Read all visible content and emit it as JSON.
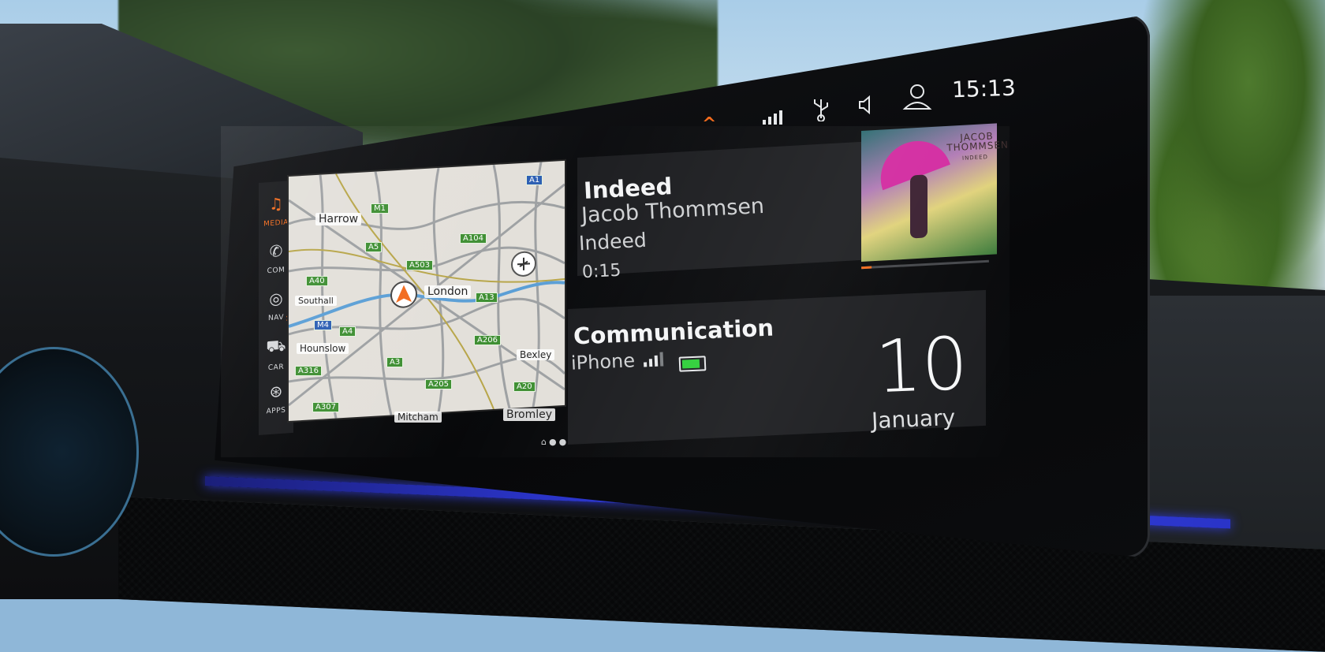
{
  "status_bar": {
    "time": "15:13",
    "icons": [
      "signal-icon",
      "usb-icon",
      "speaker-icon",
      "user-icon"
    ],
    "accent_color": "#f26b1d"
  },
  "sidebar": {
    "items": [
      {
        "label": "MEDIA",
        "icon": "music-note-icon",
        "active": true
      },
      {
        "label": "COM",
        "icon": "phone-icon",
        "active": false
      },
      {
        "label": "NAV",
        "icon": "navigation-icon",
        "active": false
      },
      {
        "label": "CAR",
        "icon": "car-icon",
        "active": false
      },
      {
        "label": "APPS",
        "icon": "apps-icon",
        "active": false
      }
    ]
  },
  "map": {
    "places": [
      "Harrow",
      "London",
      "Southall",
      "Hounslow",
      "Mitcham",
      "Bexley",
      "Bromley"
    ],
    "roads": [
      "M1",
      "A5",
      "A503",
      "A104",
      "A40",
      "A4",
      "A13",
      "A206",
      "A3",
      "A205",
      "A20",
      "A316",
      "A307",
      "M4",
      "A1"
    ]
  },
  "media": {
    "title": "Indeed",
    "artist": "Jacob Thommsen",
    "album": "Indeed",
    "elapsed": "0:15",
    "progress": 0.08,
    "cover_artist_line1": "JACOB",
    "cover_artist_line2": "THOMMSEN",
    "cover_album": "INDEED"
  },
  "communication": {
    "title": "Communication",
    "device": "iPhone",
    "battery_color": "#2fcf3a"
  },
  "date": {
    "day": "10",
    "month": "January"
  }
}
